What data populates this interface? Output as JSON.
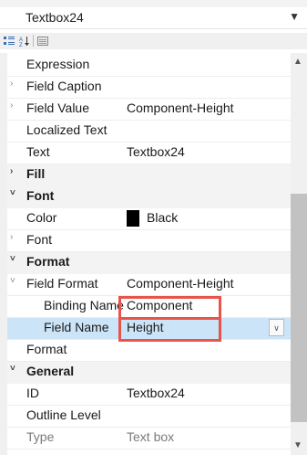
{
  "object_selector": {
    "name": "Textbox24",
    "arrow_icon": "chevron-down"
  },
  "toolbar": {
    "categorized_icon": "categorized-icon",
    "alpha_icon": "alpha-sort-icon",
    "pages_icon": "property-pages-icon"
  },
  "rows": [
    {
      "label": "Expression",
      "value": "",
      "kind": "prop",
      "expander": ""
    },
    {
      "label": "Field Caption",
      "value": "",
      "kind": "prop",
      "expander": ">"
    },
    {
      "label": "Field Value",
      "value": "Component-Height",
      "kind": "prop",
      "expander": ">"
    },
    {
      "label": "Localized Text",
      "value": "",
      "kind": "prop",
      "expander": ""
    },
    {
      "label": "Text",
      "value": "Textbox24",
      "kind": "prop",
      "expander": ""
    },
    {
      "label": "Fill",
      "value": "",
      "kind": "cat",
      "expander": ">"
    },
    {
      "label": "Font",
      "value": "",
      "kind": "cat",
      "expander": "v"
    },
    {
      "label": "Color",
      "value": "Black",
      "kind": "prop",
      "expander": "",
      "swatch": "#000000"
    },
    {
      "label": "Font",
      "value": "",
      "kind": "prop",
      "expander": ">"
    },
    {
      "label": "Format",
      "value": "",
      "kind": "cat",
      "expander": "v"
    },
    {
      "label": "Field Format",
      "value": "Component-Height",
      "kind": "prop",
      "expander": "v"
    },
    {
      "label": "Binding Name",
      "value": "Component",
      "kind": "sub",
      "expander": ""
    },
    {
      "label": "Field Name",
      "value": "Height",
      "kind": "sub",
      "expander": "",
      "selected": true
    },
    {
      "label": "Format",
      "value": "",
      "kind": "prop",
      "expander": ""
    },
    {
      "label": "General",
      "value": "",
      "kind": "cat",
      "expander": "v"
    },
    {
      "label": "ID",
      "value": "Textbox24",
      "kind": "prop",
      "expander": ""
    },
    {
      "label": "Outline Level",
      "value": "",
      "kind": "prop",
      "expander": ""
    },
    {
      "label": "Type",
      "value": "Text box",
      "kind": "prop",
      "expander": "",
      "muted": true
    }
  ],
  "colors": {
    "highlight_box": "#e8534a",
    "selected_row": "#cce4f7",
    "category_band": "#f3f3f3"
  }
}
